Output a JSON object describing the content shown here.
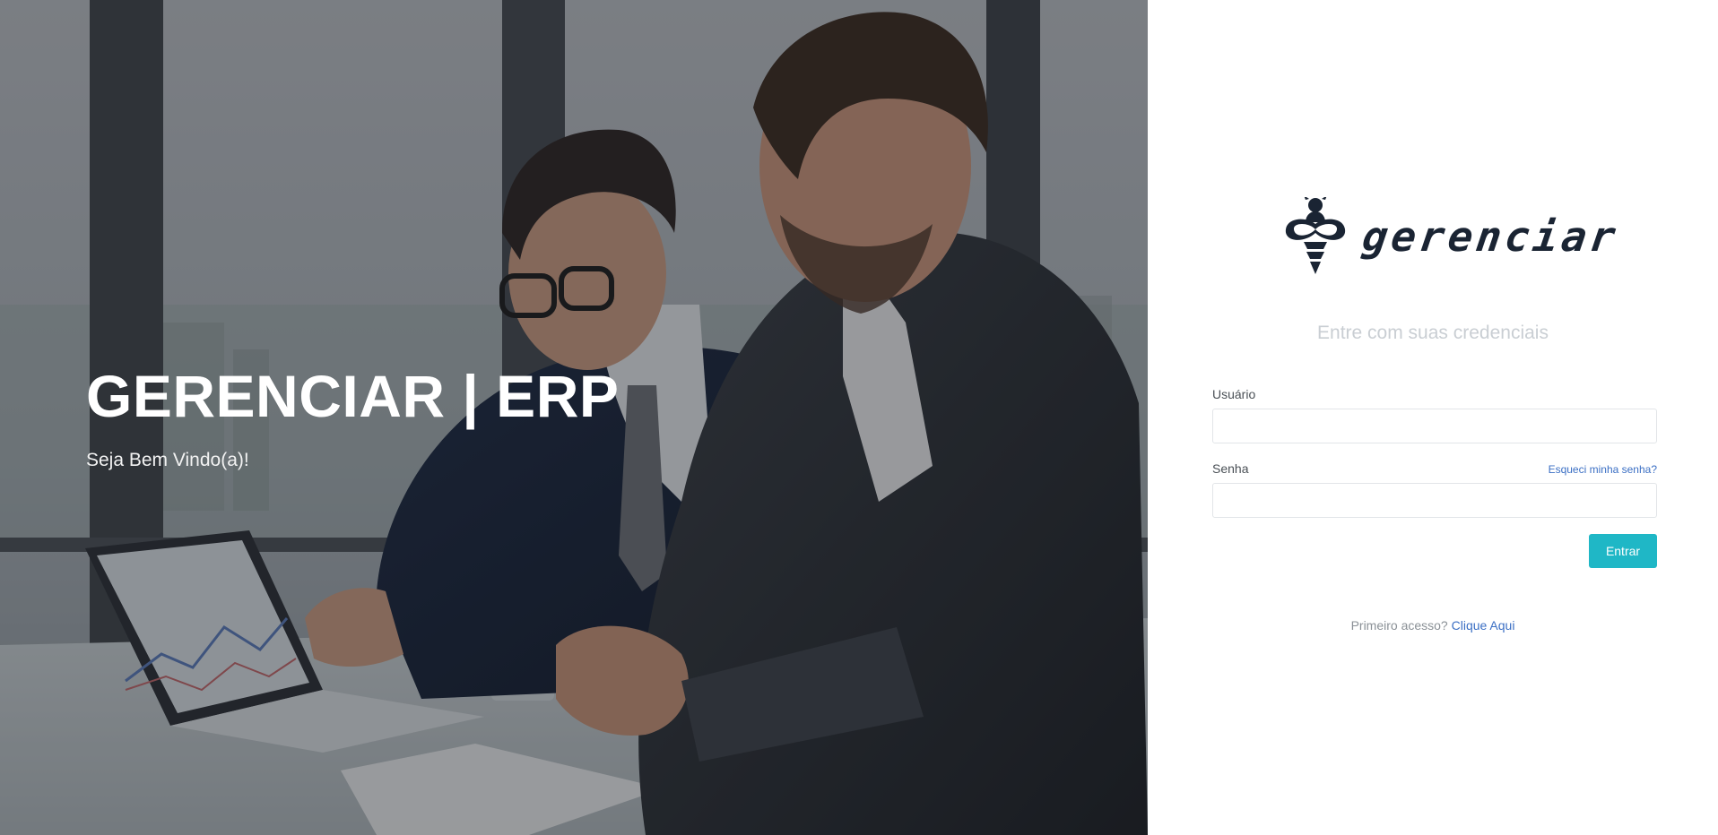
{
  "hero": {
    "title": "GERENCIAR | ERP",
    "subtitle": "Seja Bem Vindo(a)!",
    "image": "two-businessmen-office-laptop-photo"
  },
  "login": {
    "logo_text": "gerenciar",
    "logo_icon": "bee-infinity-icon",
    "heading": "Entre com suas credenciais",
    "username_label": "Usuário",
    "username_value": "",
    "password_label": "Senha",
    "password_value": "",
    "forgot_link": "Esqueci minha senha?",
    "submit_label": "Entrar",
    "first_access_text": "Primeiro acesso?",
    "first_access_link": "Clique Aqui"
  },
  "colors": {
    "accent": "#1fb7c6",
    "link": "#3b6fc4",
    "logo": "#1a2433",
    "heading_muted": "#c9ced3"
  }
}
